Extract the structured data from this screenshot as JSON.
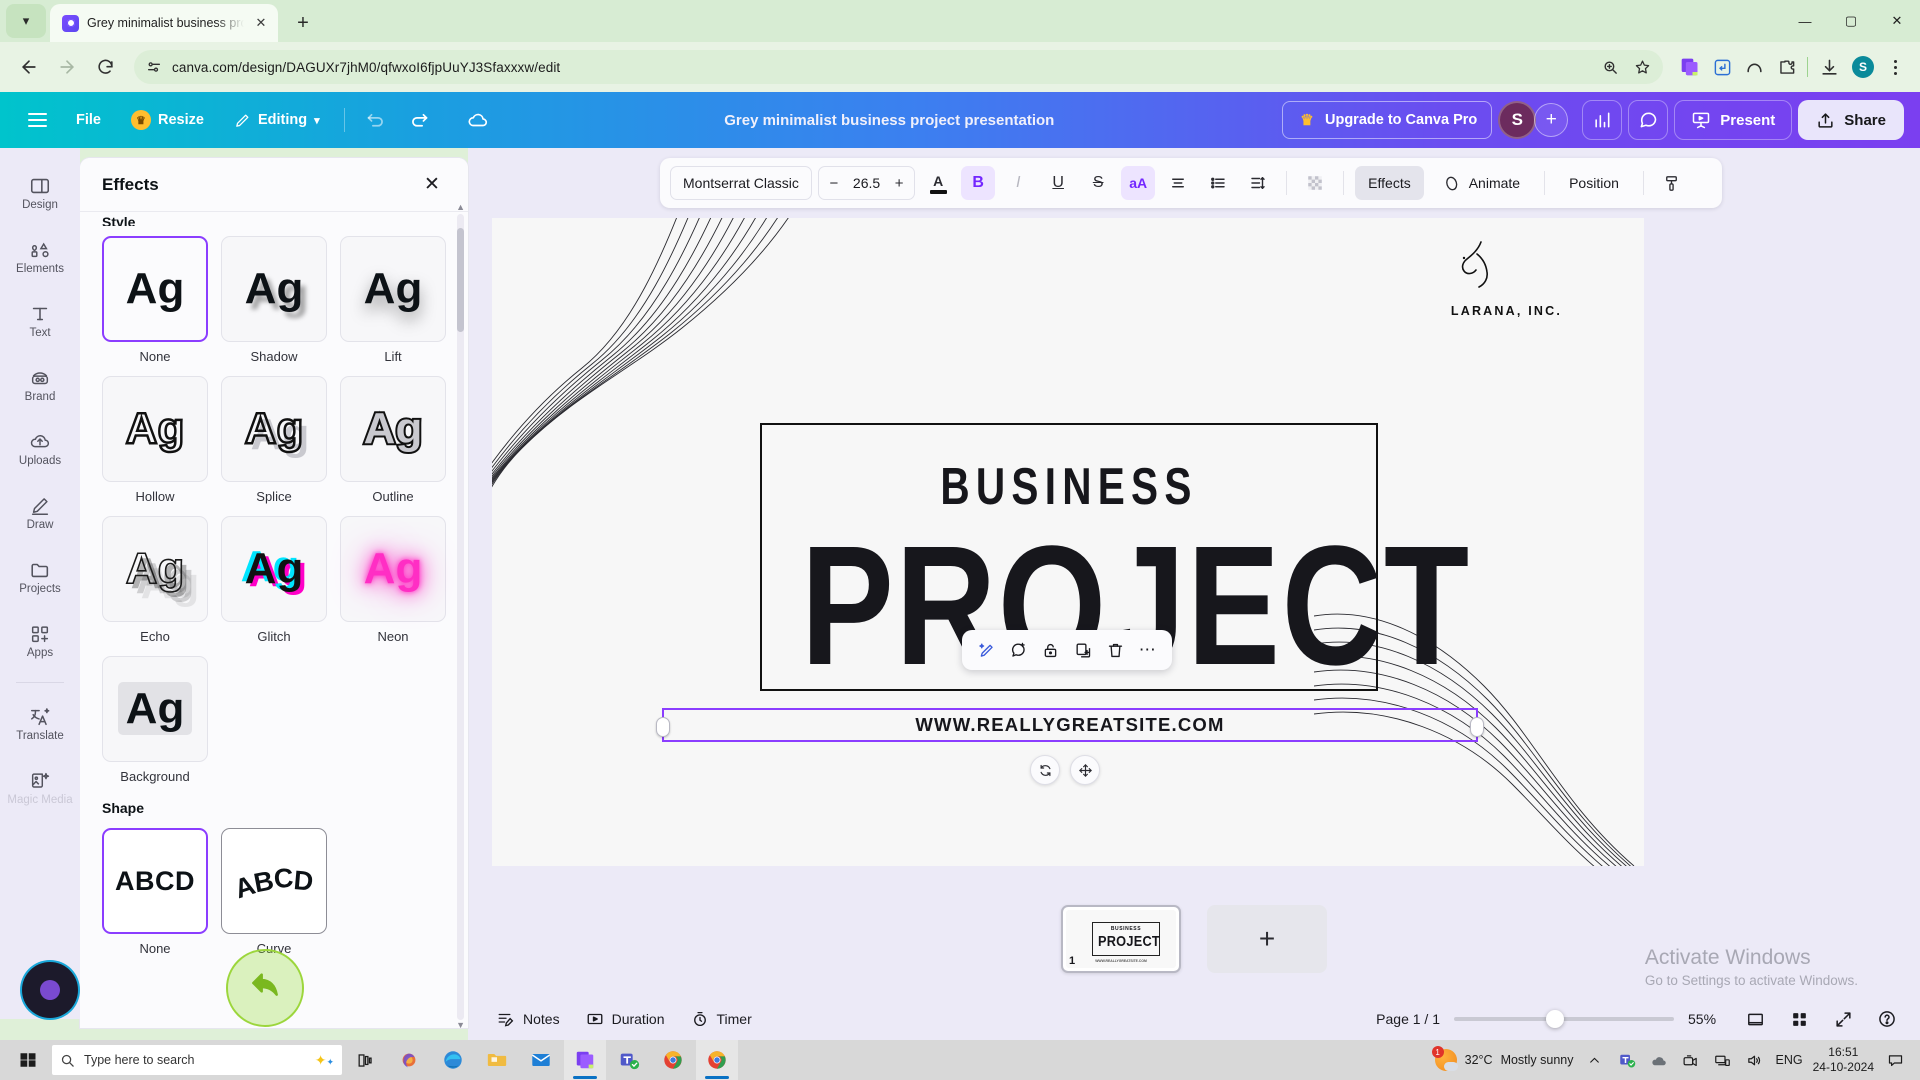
{
  "browser": {
    "tab": {
      "title": "Grey minimalist business projec",
      "favicon": "canva-icon"
    },
    "new_tab_label": "+",
    "url": "canva.com/design/DAGUXr7jhM0/qfwxoI6fjpUuYJ3Sfaxxxw/edit",
    "window_controls": {
      "minimize": "—",
      "maximize": "▢",
      "close": "✕"
    },
    "profile_initial": "S"
  },
  "header": {
    "menu_items": [
      {
        "label": "File",
        "icon": "none"
      },
      {
        "label": "Resize",
        "icon": "crown-icon"
      },
      {
        "label": "Editing",
        "icon": "pencil-icon"
      }
    ],
    "title": "Grey minimalist business project presentation",
    "upgrade_label": "Upgrade to Canva Pro",
    "avatar_initial": "S",
    "plus_label": "+",
    "present_label": "Present",
    "share_label": "Share"
  },
  "sidebar": {
    "items": [
      {
        "label": "Design",
        "icon": "design-icon"
      },
      {
        "label": "Elements",
        "icon": "elements-icon"
      },
      {
        "label": "Text",
        "icon": "text-icon"
      },
      {
        "label": "Brand",
        "icon": "brand-icon"
      },
      {
        "label": "Uploads",
        "icon": "uploads-icon"
      },
      {
        "label": "Draw",
        "icon": "draw-icon"
      },
      {
        "label": "Projects",
        "icon": "projects-icon"
      },
      {
        "label": "Apps",
        "icon": "apps-icon"
      },
      {
        "label": "Translate",
        "icon": "translate-icon"
      },
      {
        "label": "Magic Media",
        "icon": "magic-media-icon"
      }
    ]
  },
  "effects_panel": {
    "title": "Effects",
    "close_label": "✕",
    "style_section_label": "Style",
    "shape_section_label": "Shape",
    "sample_glyph": "Ag",
    "shape_glyph": "ABCD",
    "styles": [
      {
        "label": "None",
        "selected": true
      },
      {
        "label": "Shadow",
        "selected": false
      },
      {
        "label": "Lift",
        "selected": false
      },
      {
        "label": "Hollow",
        "selected": false
      },
      {
        "label": "Splice",
        "selected": false
      },
      {
        "label": "Outline",
        "selected": false
      },
      {
        "label": "Echo",
        "selected": false
      },
      {
        "label": "Glitch",
        "selected": false
      },
      {
        "label": "Neon",
        "selected": false
      },
      {
        "label": "Background",
        "selected": false
      }
    ],
    "shapes": [
      {
        "label": "None",
        "selected": true
      },
      {
        "label": "Curve",
        "selected": false
      }
    ],
    "accent_color": "#8b3dff",
    "cursor_highlight_color": "#9cd63c"
  },
  "options_toolbar": {
    "font_name": "Montserrat Classic",
    "font_size": "26.5",
    "decrement": "−",
    "increment": "+",
    "buttons": [
      {
        "label": "A",
        "name": "text-color-button",
        "active": false
      },
      {
        "label": "B",
        "name": "bold-button",
        "active": true
      },
      {
        "label": "I",
        "name": "italic-button",
        "active": false,
        "disabled": true
      },
      {
        "label": "U",
        "name": "underline-button",
        "active": false
      },
      {
        "label": "S",
        "name": "strikethrough-button",
        "active": false
      },
      {
        "label": "aA",
        "name": "letter-case-button",
        "active": true
      }
    ],
    "effects_label": "Effects",
    "animate_label": "Animate",
    "position_label": "Position"
  },
  "canvas": {
    "logo_text": "LARANA, INC.",
    "title_line1": "BUSINESS",
    "title_line2": "PROJECT",
    "url_text": "WWW.REALLYGREATSITE.COM",
    "float_toolbar": [
      {
        "name": "magic-edit-icon",
        "label": "✎"
      },
      {
        "name": "comment-icon",
        "label": "💬"
      },
      {
        "name": "lock-icon",
        "label": "🔓"
      },
      {
        "name": "duplicate-icon",
        "label": "⧉"
      },
      {
        "name": "delete-icon",
        "label": "🗑"
      },
      {
        "name": "more-icon",
        "label": "⋯"
      }
    ],
    "object_controls": [
      {
        "name": "rotate-handle",
        "label": "⟳"
      },
      {
        "name": "move-handle",
        "label": "✥"
      }
    ]
  },
  "pages_strip": {
    "page_number": "1",
    "thumb_title_top": "BUSINESS",
    "thumb_title_main": "PROJECT",
    "thumb_url": "WWW.REALLYGREATSITE.COM",
    "add_page_label": "+"
  },
  "status_bar": {
    "notes_label": "Notes",
    "duration_label": "Duration",
    "timer_label": "Timer",
    "page_indicator": "Page 1 / 1",
    "zoom_level": "55%",
    "icons": [
      {
        "name": "fit-screen-icon"
      },
      {
        "name": "grid-view-icon"
      },
      {
        "name": "fullscreen-icon"
      },
      {
        "name": "help-icon"
      }
    ]
  },
  "watermark": {
    "line1": "Activate Windows",
    "line2": "Go to Settings to activate Windows."
  },
  "taskbar": {
    "search_placeholder": "Type here to search",
    "weather_temp": "32°C",
    "weather_desc": "Mostly sunny",
    "language": "ENG",
    "time": "16:51",
    "date": "24-10-2024",
    "notification_badge": "1"
  }
}
